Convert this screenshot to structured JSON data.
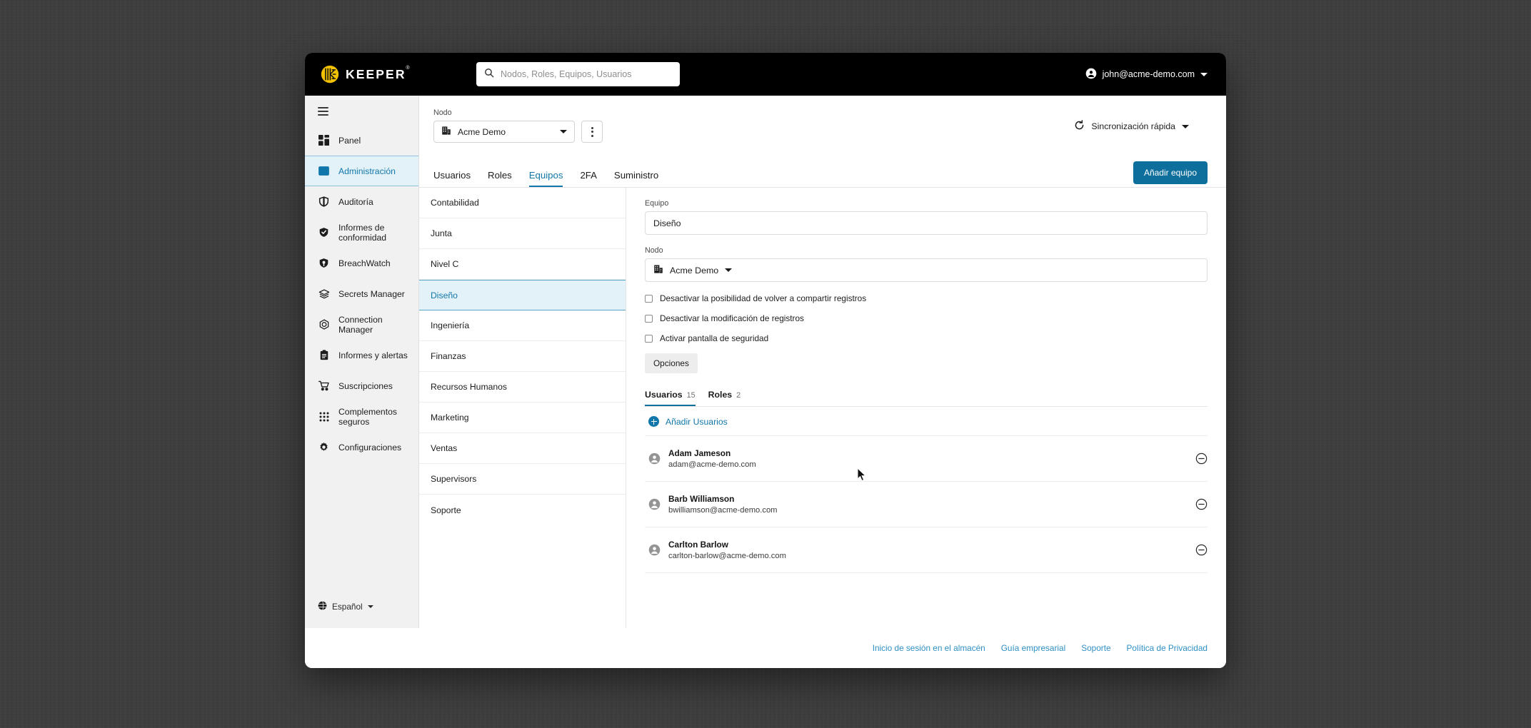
{
  "app": {
    "brand": "KEEPER",
    "brand_tm": "®"
  },
  "topbar": {
    "search_placeholder": "Nodos, Roles, Equipos, Usuarios",
    "search_icon": "search-icon",
    "account_email": "john@acme-demo.com",
    "account_icon": "account-circle-icon"
  },
  "sidebar": {
    "menu_icon": "hamburger-icon",
    "items": [
      {
        "label": "Panel",
        "icon": "dashboard-icon",
        "active": false
      },
      {
        "label": "Administración",
        "icon": "admin-panel-icon",
        "active": true
      },
      {
        "label": "Auditoría",
        "icon": "shield-outline-icon",
        "active": false
      },
      {
        "label": "Informes de conformidad",
        "icon": "shield-check-icon",
        "active": false
      },
      {
        "label": "BreachWatch",
        "icon": "breachwatch-icon",
        "active": false
      },
      {
        "label": "Secrets Manager",
        "icon": "layers-icon",
        "active": false
      },
      {
        "label": "Connection Manager",
        "icon": "hexagon-icon",
        "active": false
      },
      {
        "label": "Informes y alertas",
        "icon": "clipboard-icon",
        "active": false
      },
      {
        "label": "Suscripciones",
        "icon": "cart-icon",
        "active": false
      },
      {
        "label": "Complementos seguros",
        "icon": "grid-dots-icon",
        "active": false
      },
      {
        "label": "Configuraciones",
        "icon": "gear-icon",
        "active": false
      }
    ],
    "language": {
      "label": "Español",
      "icon": "globe-icon"
    }
  },
  "main": {
    "node_label": "Nodo",
    "node_value": "Acme Demo",
    "node_icon": "building-icon",
    "kebab_icon": "more-vertical-icon",
    "quick_sync": {
      "label": "Sincronización rápida",
      "icon": "refresh-icon"
    },
    "tabs": [
      {
        "label": "Usuarios",
        "active": false
      },
      {
        "label": "Roles",
        "active": false
      },
      {
        "label": "Equipos",
        "active": true
      },
      {
        "label": "2FA",
        "active": false
      },
      {
        "label": "Suministro",
        "active": false
      }
    ],
    "add_team_button": "Añadir equipo"
  },
  "teams": [
    {
      "label": "Contabilidad",
      "active": false
    },
    {
      "label": "Junta",
      "active": false
    },
    {
      "label": "Nivel C",
      "active": false
    },
    {
      "label": "Diseño",
      "active": true
    },
    {
      "label": "Ingeniería",
      "active": false
    },
    {
      "label": "Finanzas",
      "active": false
    },
    {
      "label": "Recursos Humanos",
      "active": false
    },
    {
      "label": "Marketing",
      "active": false
    },
    {
      "label": "Ventas",
      "active": false
    },
    {
      "label": "Supervisors",
      "active": false
    },
    {
      "label": "Soporte",
      "active": false
    }
  ],
  "detail": {
    "team_label": "Equipo",
    "team_value": "Diseño",
    "node_label": "Nodo",
    "node_value": "Acme Demo",
    "node_icon": "building-icon",
    "checkboxes": [
      {
        "label": "Desactivar la posibilidad de volver a compartir registros",
        "checked": false
      },
      {
        "label": "Desactivar la modificación de registros",
        "checked": false
      },
      {
        "label": "Activar pantalla de seguridad",
        "checked": false
      }
    ],
    "options_button": "Opciones",
    "subtabs": [
      {
        "label": "Usuarios",
        "count": "15",
        "active": true
      },
      {
        "label": "Roles",
        "count": "2",
        "active": false
      }
    ],
    "add_users_label": "Añadir Usuarios",
    "add_users_icon": "plus-circle-icon",
    "users": [
      {
        "name": "Adam Jameson",
        "email": "adam@acme-demo.com",
        "remove_icon": "remove-circle-icon"
      },
      {
        "name": "Barb Williamson",
        "email": "bwilliamson@acme-demo.com",
        "remove_icon": "remove-circle-icon"
      },
      {
        "name": "Carlton Barlow",
        "email": "carlton-barlow@acme-demo.com",
        "remove_icon": "remove-circle-icon"
      }
    ]
  },
  "footer": {
    "links": [
      "Inicio de sesión en el almacén",
      "Guía empresarial",
      "Soporte",
      "Política de Privacidad"
    ]
  },
  "colors": {
    "brand_yellow": "#F2C200",
    "accent_blue": "#1177AB",
    "button_blue": "#0E6E9C",
    "topbar_black": "#000000",
    "sidebar_grey": "#F1F1F1",
    "active_row_bg": "#E3F1F8",
    "desktop_bg": "#3D3D3D"
  }
}
